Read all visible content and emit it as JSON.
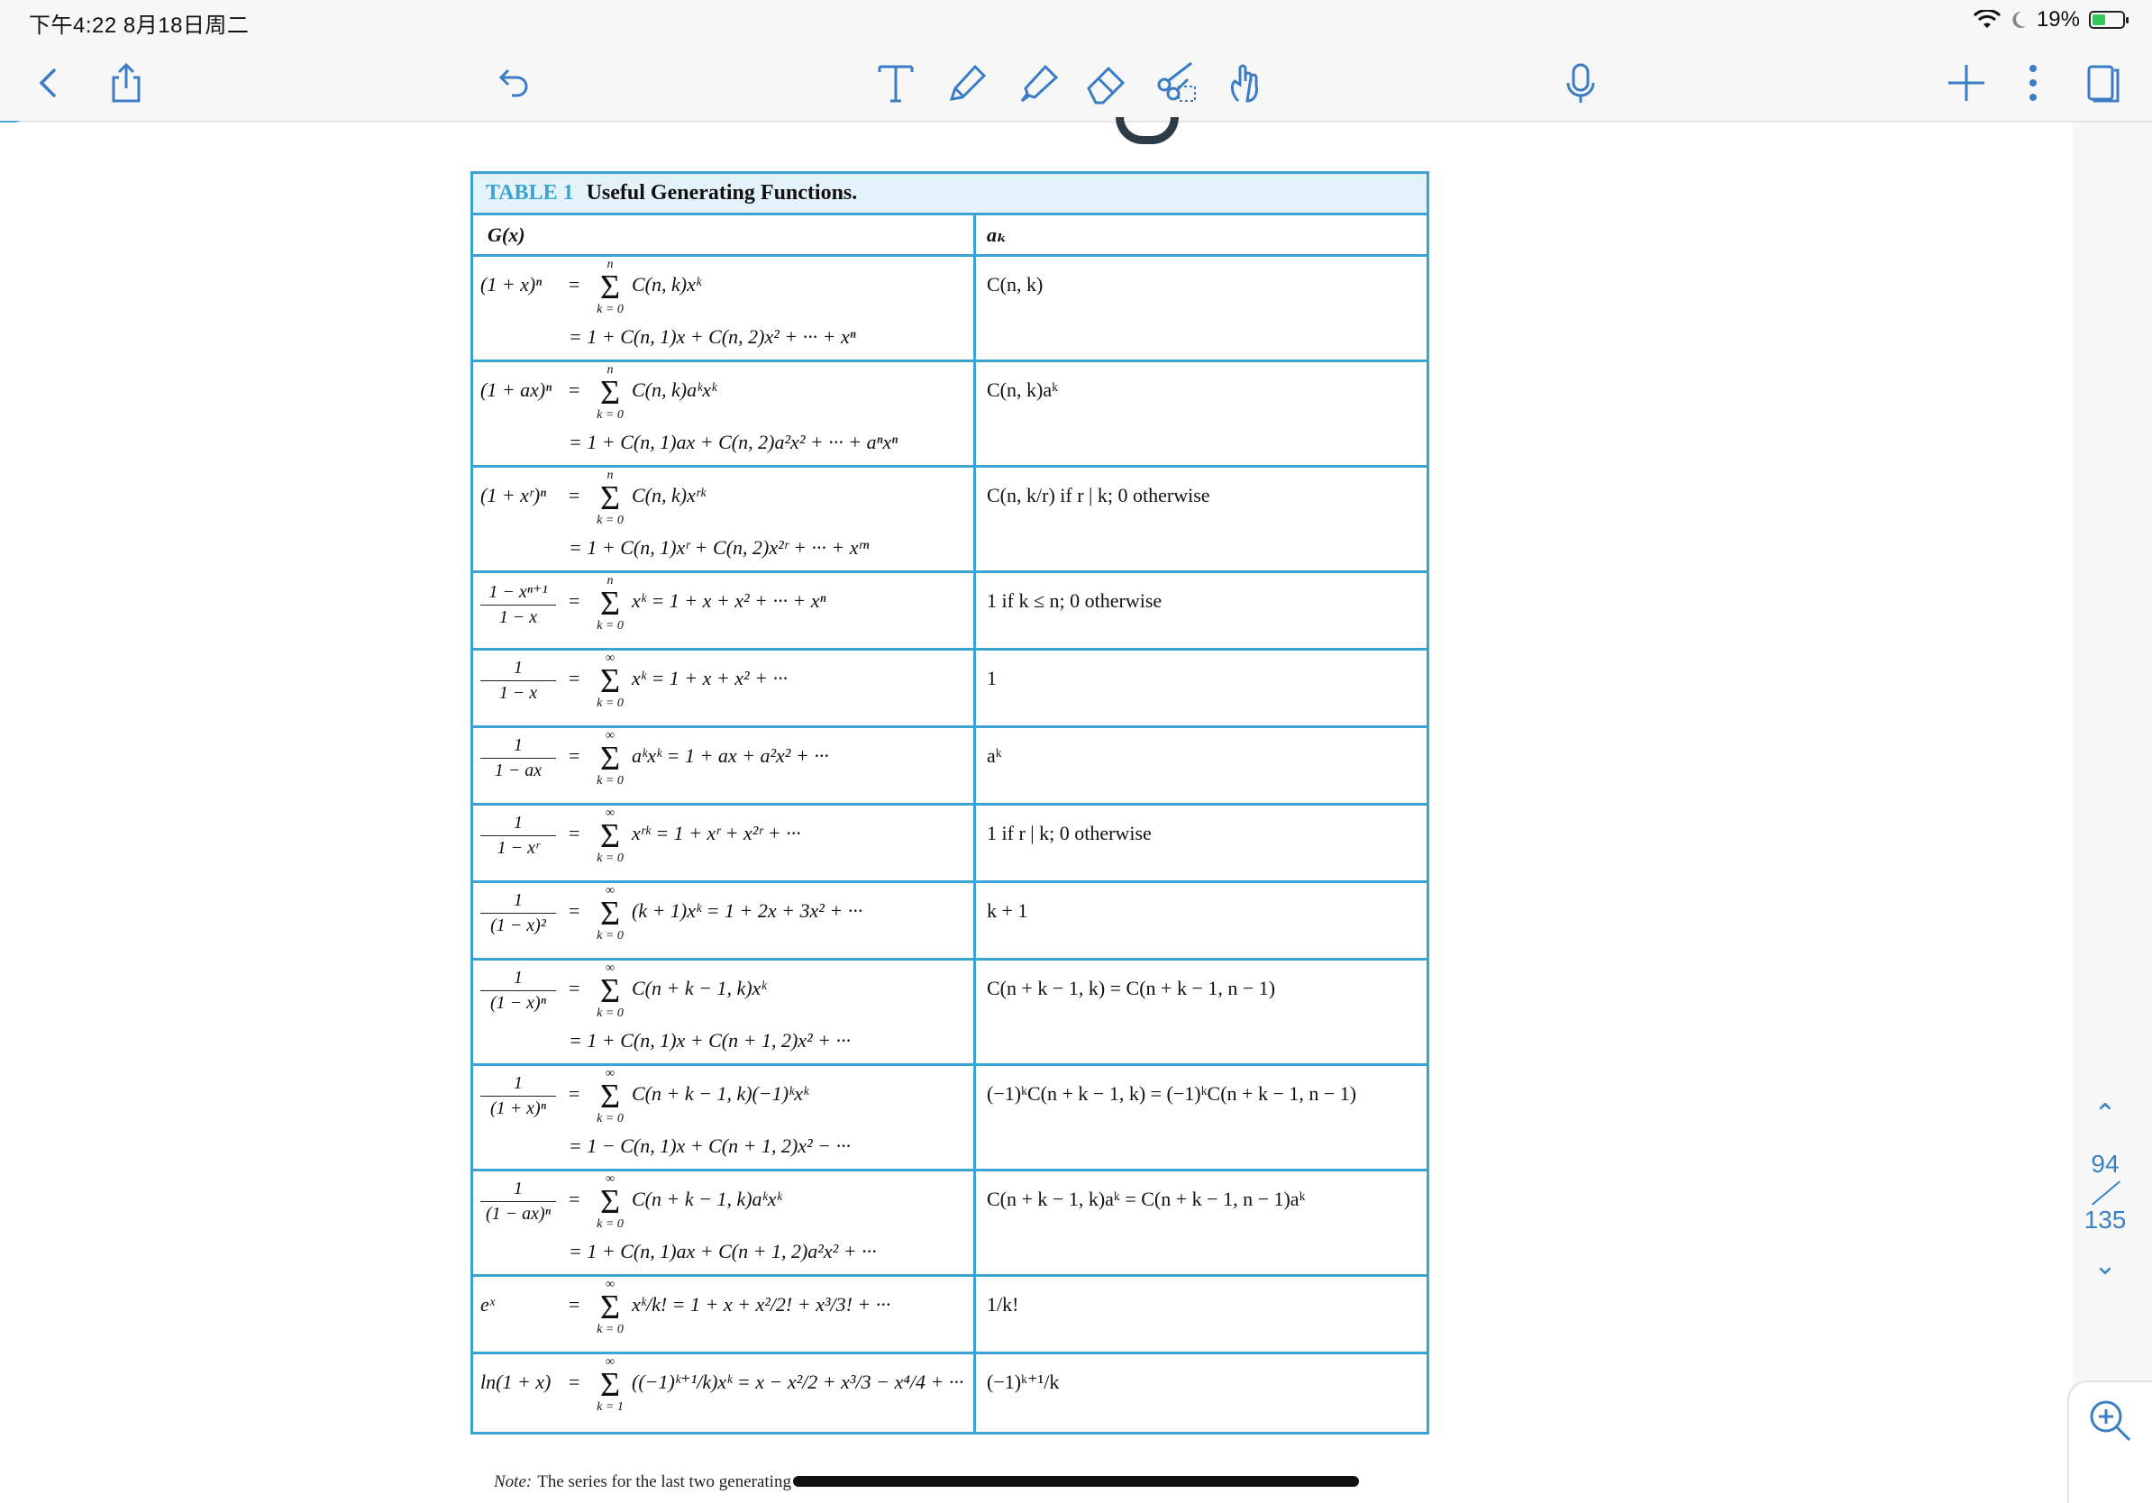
{
  "status_bar": {
    "time_date": "下午4:22   8月18日周二",
    "battery": "19%"
  },
  "toolbar": {
    "back": "back-chevron",
    "share": "share",
    "undo": "undo",
    "tools": [
      "text",
      "pen",
      "highlighter",
      "eraser",
      "lasso-scissors",
      "hand"
    ],
    "mic": "microphone",
    "add": "add",
    "more": "more",
    "pages": "pages"
  },
  "table": {
    "tag": "TABLE 1",
    "caption": "Useful Generating Functions.",
    "col_gx": "G(x)",
    "col_ak": "aₖ",
    "rows": [
      {
        "lhs": "(1 + x)ⁿ",
        "up": "n",
        "lo": "k = 0",
        "f1": "C(n, k)xᵏ",
        "f2": "= 1 + C(n, 1)x + C(n, 2)x² + ··· + xⁿ",
        "ak": "C(n, k)"
      },
      {
        "lhs": "(1 + ax)ⁿ",
        "up": "n",
        "lo": "k = 0",
        "f1": "C(n, k)aᵏxᵏ",
        "f2": "= 1 + C(n, 1)ax + C(n, 2)a²x² + ··· + aⁿxⁿ",
        "ak": "C(n, k)aᵏ"
      },
      {
        "lhs": "(1 + xʳ)ⁿ",
        "up": "n",
        "lo": "k = 0",
        "f1": "C(n, k)xʳᵏ",
        "f2": "= 1 + C(n, 1)xʳ + C(n, 2)x²ʳ + ··· + xʳⁿ",
        "ak": "C(n, k/r) if r | k; 0 otherwise"
      },
      {
        "num": "1 − xⁿ⁺¹",
        "den": "1 − x",
        "up": "n",
        "lo": "k = 0",
        "f1": "xᵏ = 1 + x + x² + ··· + xⁿ",
        "f2": "",
        "ak": "1 if k ≤ n; 0 otherwise"
      },
      {
        "num": "1",
        "den": "1 − x",
        "up": "∞",
        "lo": "k = 0",
        "f1": "xᵏ = 1 + x + x² + ···",
        "f2": "",
        "ak": "1"
      },
      {
        "num": "1",
        "den": "1 − ax",
        "up": "∞",
        "lo": "k = 0",
        "f1": "aᵏxᵏ = 1 + ax + a²x² + ···",
        "f2": "",
        "ak": "aᵏ"
      },
      {
        "num": "1",
        "den": "1 − xʳ",
        "up": "∞",
        "lo": "k = 0",
        "f1": "xʳᵏ = 1 + xʳ + x²ʳ + ···",
        "f2": "",
        "ak": "1 if r | k; 0 otherwise"
      },
      {
        "num": "1",
        "den": "(1 − x)²",
        "up": "∞",
        "lo": "k = 0",
        "f1": "(k + 1)xᵏ = 1 + 2x + 3x² + ···",
        "f2": "",
        "ak": "k + 1"
      },
      {
        "num": "1",
        "den": "(1 − x)ⁿ",
        "up": "∞",
        "lo": "k = 0",
        "f1": "C(n + k − 1, k)xᵏ",
        "f2": "= 1 + C(n, 1)x + C(n + 1, 2)x² + ···",
        "ak": "C(n + k − 1, k) = C(n + k − 1, n − 1)"
      },
      {
        "num": "1",
        "den": "(1 + x)ⁿ",
        "up": "∞",
        "lo": "k = 0",
        "f1": "C(n + k − 1, k)(−1)ᵏxᵏ",
        "f2": "= 1 − C(n, 1)x + C(n + 1, 2)x² − ···",
        "ak": "(−1)ᵏC(n + k − 1, k) = (−1)ᵏC(n + k − 1, n − 1)"
      },
      {
        "num": "1",
        "den": "(1 − ax)ⁿ",
        "up": "∞",
        "lo": "k = 0",
        "f1": "C(n + k − 1, k)aᵏxᵏ",
        "f2": "= 1 + C(n, 1)ax + C(n + 1, 2)a²x² + ···",
        "ak": "C(n + k − 1, k)aᵏ = C(n + k − 1, n − 1)aᵏ"
      },
      {
        "lhs": "eˣ",
        "up": "∞",
        "lo": "k = 0",
        "f1": "xᵏ/k! = 1 + x + x²/2! + x³/3! + ···",
        "f2": "",
        "ak": "1/k!"
      },
      {
        "lhs": "ln(1 + x)",
        "up": "∞",
        "lo": "k = 1",
        "f1": "((−1)ᵏ⁺¹/k)xᵏ = x − x²/2 + x³/3 − x⁴/4 + ···",
        "f2": "",
        "ak": "(−1)ᵏ⁺¹/k"
      }
    ]
  },
  "note": {
    "label": "Note:",
    "text": "The series for the last two generating"
  },
  "page_nav": {
    "current": "94",
    "total": "135"
  }
}
